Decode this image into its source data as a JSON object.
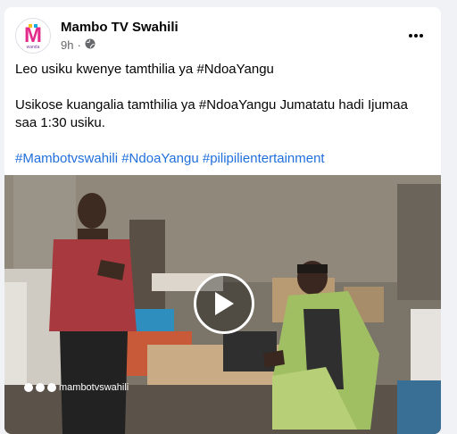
{
  "post": {
    "page_name": "Mambo TV Swahili",
    "time": "9h",
    "separator": "·",
    "privacy_icon": "globe-icon",
    "more_icon": "ellipsis-icon",
    "avatar_logo": "M wanda",
    "text": {
      "line1": "Leo usiku kwenye tamthilia ya #NdoaYangu",
      "line2": "Usikose kuangalia tamthilia ya #NdoaYangu Jumatatu hadi Ijumaa saa 1:30 usiku.",
      "hashtags": [
        "#Mambotvswahili",
        "#NdoaYangu",
        "#pilipilientertainment"
      ]
    }
  },
  "video": {
    "play_icon": "play-icon",
    "watermark_handle": "mambotvswahili",
    "watermark_icons": [
      "instagram-icon",
      "twitter-icon",
      "facebook-icon"
    ]
  },
  "colors": {
    "link": "#216fdb",
    "background": "#f0f2f5",
    "secondary_text": "#65676b"
  }
}
